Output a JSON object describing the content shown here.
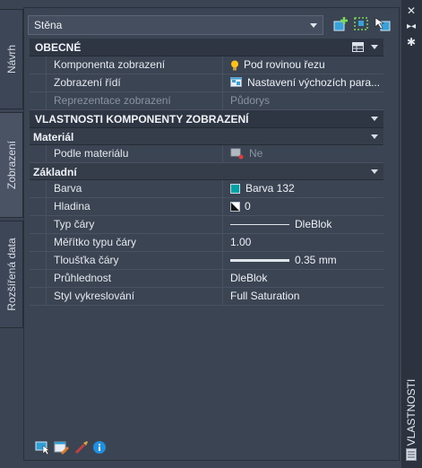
{
  "style_select": {
    "value": "Stěna"
  },
  "side_tabs": [
    {
      "label": "Návrh"
    },
    {
      "label": "Zobrazení"
    },
    {
      "label": "Rozšířená data"
    }
  ],
  "right_bar": {
    "title": "VLASTNOSTI"
  },
  "sections": {
    "general": {
      "title": "OBECNÉ",
      "rows": [
        {
          "name": "Komponenta zobrazení",
          "value": "Pod rovinou řezu",
          "icon": "lightbulb-icon"
        },
        {
          "name": "Zobrazení řídí",
          "value": "Nastavení výchozích para...",
          "icon": "display-settings-icon"
        },
        {
          "name": "Reprezentace zobrazení",
          "value": "Půdorys"
        }
      ]
    },
    "display_component": {
      "title": "VLASTNOSTI KOMPONENTY ZOBRAZENÍ"
    },
    "material": {
      "title": "Materiál",
      "rows": [
        {
          "name": "Podle materiálu",
          "value": "Ne",
          "icon": "material-icon"
        }
      ]
    },
    "basic": {
      "title": "Základní",
      "rows": [
        {
          "name": "Barva",
          "value": "Barva 132",
          "color": "#00a3a3"
        },
        {
          "name": "Hladina",
          "value": "0",
          "icon": "layer-icon"
        },
        {
          "name": "Typ čáry",
          "value": "DleBlok"
        },
        {
          "name": "Měřítko typu čáry",
          "value": "1.00"
        },
        {
          "name": "Tloušťka čáry",
          "value": "0.35 mm"
        },
        {
          "name": "Průhlednost",
          "value": "DleBlok"
        },
        {
          "name": "Styl vykreslování",
          "value": "Full Saturation"
        }
      ]
    }
  }
}
